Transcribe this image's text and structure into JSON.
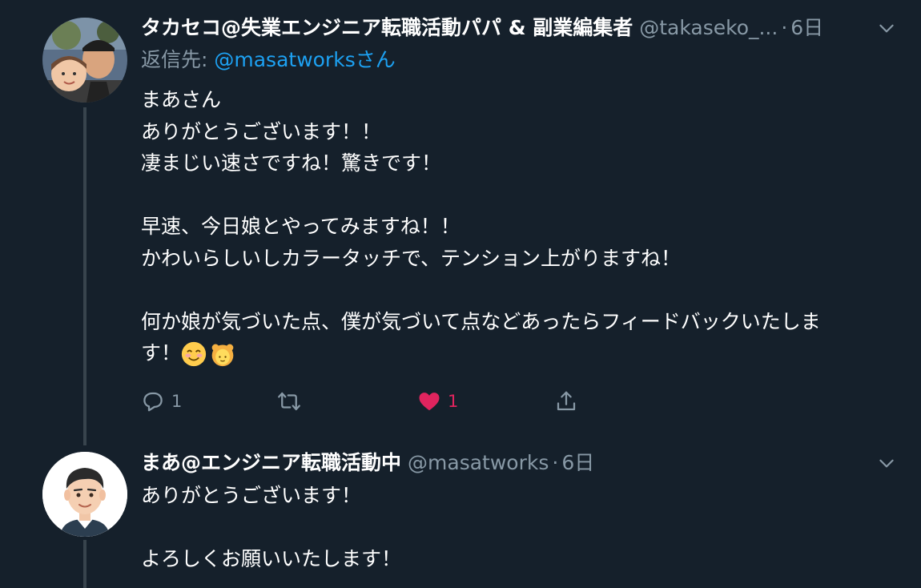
{
  "tweets": [
    {
      "name": "タカセコ@失業エンジニア転職活動パパ & 副業編集者",
      "handle": "@takaseko_...",
      "dot": "·",
      "time": "6日",
      "reply_prefix": "返信先: ",
      "reply_mention": "@masatworks",
      "reply_suffix": "さん",
      "lines": [
        "まあさん",
        "ありがとうございます！！",
        "凄まじい速さですね！驚きです！",
        "",
        "早速、今日娘とやってみますね！！",
        "かわいらしいしカラータッチで、テンション上がりますね！",
        "",
        "何か娘が気づいた点、僕が気づいて点などあったらフィードバックいたしま",
        "す！"
      ],
      "emojis": [
        "smiling-face-emoji",
        "girl-emoji"
      ],
      "actions": {
        "reply_count": "1",
        "retweet_count": "",
        "like_count": "1",
        "liked": true
      }
    },
    {
      "name": "まあ@エンジニア転職活動中",
      "handle": "@masatworks",
      "dot": "·",
      "time": "6日",
      "lines": [
        "ありがとうございます！",
        "",
        "よろしくお願いいたします！"
      ]
    }
  ],
  "colors": {
    "background": "#15202b",
    "secondary_text": "#8899a6",
    "link": "#1da1f2",
    "like": "#e0245e",
    "thread_line": "#38444d"
  }
}
